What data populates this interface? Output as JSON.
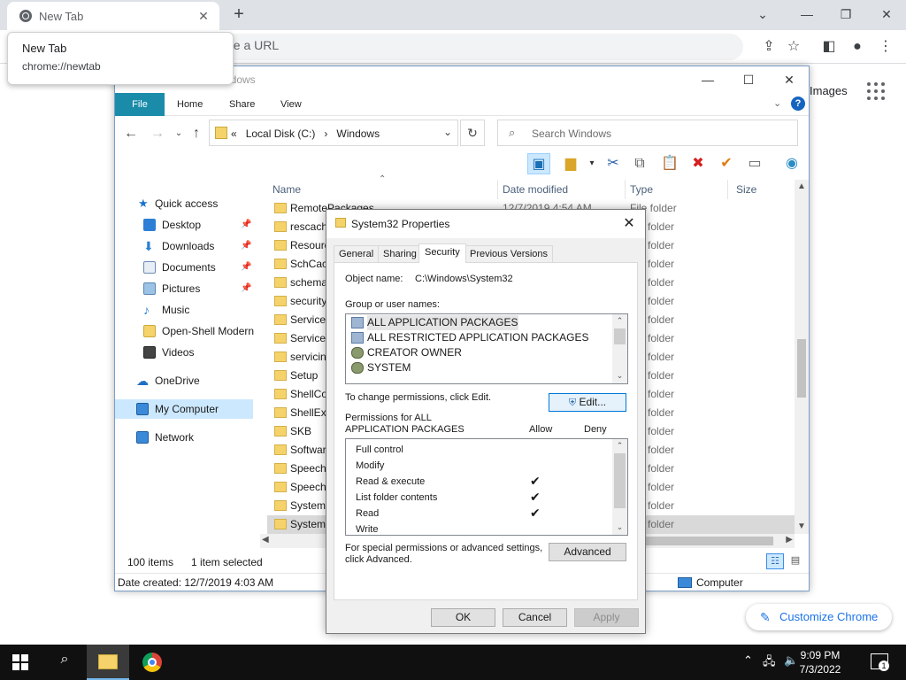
{
  "browser": {
    "tab_title": "New Tab",
    "tooltip_title": "New Tab",
    "tooltip_url": "chrome://newtab",
    "omnibox_placeholder": "pe a URL",
    "images_link": "Images",
    "customize_label": "Customize Chrome"
  },
  "explorer": {
    "title": "Windows",
    "ribbon_tabs": [
      "File",
      "Home",
      "Share",
      "View"
    ],
    "address": {
      "prefix": "«",
      "path1": "Local Disk (C:)",
      "separator": "›",
      "path2": "Windows"
    },
    "search_placeholder": "Search Windows",
    "nav_items": [
      {
        "label": "Quick access"
      },
      {
        "label": "Desktop"
      },
      {
        "label": "Downloads"
      },
      {
        "label": "Documents"
      },
      {
        "label": "Pictures"
      },
      {
        "label": "Music"
      },
      {
        "label": "Open-Shell Modern"
      },
      {
        "label": "Videos"
      },
      {
        "label": "OneDrive"
      },
      {
        "label": "My Computer"
      },
      {
        "label": "Network"
      }
    ],
    "columns": {
      "name": "Name",
      "date": "Date modified",
      "type": "Type",
      "size": "Size"
    },
    "rows": [
      {
        "name": "RemotePackages",
        "date": "12/7/2019 4:54 AM",
        "type": "File folder"
      },
      {
        "name": "rescach",
        "type": "folder"
      },
      {
        "name": "Resourc",
        "type": "folder"
      },
      {
        "name": "SchCac",
        "type": "folder"
      },
      {
        "name": "schema",
        "type": "folder"
      },
      {
        "name": "security",
        "type": "folder"
      },
      {
        "name": "ServiceP",
        "type": "folder"
      },
      {
        "name": "ServiceS",
        "type": "folder"
      },
      {
        "name": "servicin",
        "type": "folder"
      },
      {
        "name": "Setup",
        "type": "folder"
      },
      {
        "name": "ShellCo",
        "type": "folder"
      },
      {
        "name": "ShellExp",
        "type": "folder"
      },
      {
        "name": "SKB",
        "type": "folder"
      },
      {
        "name": "Softwar",
        "type": "folder"
      },
      {
        "name": "Speech",
        "type": "folder"
      },
      {
        "name": "Speech_",
        "type": "folder"
      },
      {
        "name": "System",
        "type": "folder"
      },
      {
        "name": "System3",
        "type": "folder"
      }
    ],
    "status": {
      "items_count": "100 items",
      "selected": "1 item selected",
      "date_created": "Date created: 12/7/2019 4:03 AM",
      "location": "Computer"
    }
  },
  "dialog": {
    "title": "System32 Properties",
    "tabs": [
      "General",
      "Sharing",
      "Security",
      "Previous Versions"
    ],
    "object_name_label": "Object name:",
    "object_name_value": "C:\\Windows\\System32",
    "group_label": "Group or user names:",
    "groups": [
      {
        "label": "ALL APPLICATION PACKAGES"
      },
      {
        "label": "ALL RESTRICTED APPLICATION PACKAGES"
      },
      {
        "label": "CREATOR OWNER"
      },
      {
        "label": "SYSTEM"
      }
    ],
    "change_perm_text": "To change permissions, click Edit.",
    "edit_button": "Edit...",
    "perm_for_line1": "Permissions for ALL",
    "perm_for_line2": "APPLICATION PACKAGES",
    "allow_label": "Allow",
    "deny_label": "Deny",
    "permissions": [
      {
        "name": "Full control",
        "allow": ""
      },
      {
        "name": "Modify",
        "allow": ""
      },
      {
        "name": "Read & execute",
        "allow": "✔"
      },
      {
        "name": "List folder contents",
        "allow": "✔"
      },
      {
        "name": "Read",
        "allow": "✔"
      },
      {
        "name": "Write",
        "allow": ""
      }
    ],
    "special_line1": "For special permissions or advanced settings,",
    "special_line2": "click Advanced.",
    "advanced_button": "Advanced",
    "ok_button": "OK",
    "cancel_button": "Cancel",
    "apply_button": "Apply"
  },
  "taskbar": {
    "time": "9:09 PM",
    "date": "7/3/2022",
    "notification_count": "1"
  }
}
